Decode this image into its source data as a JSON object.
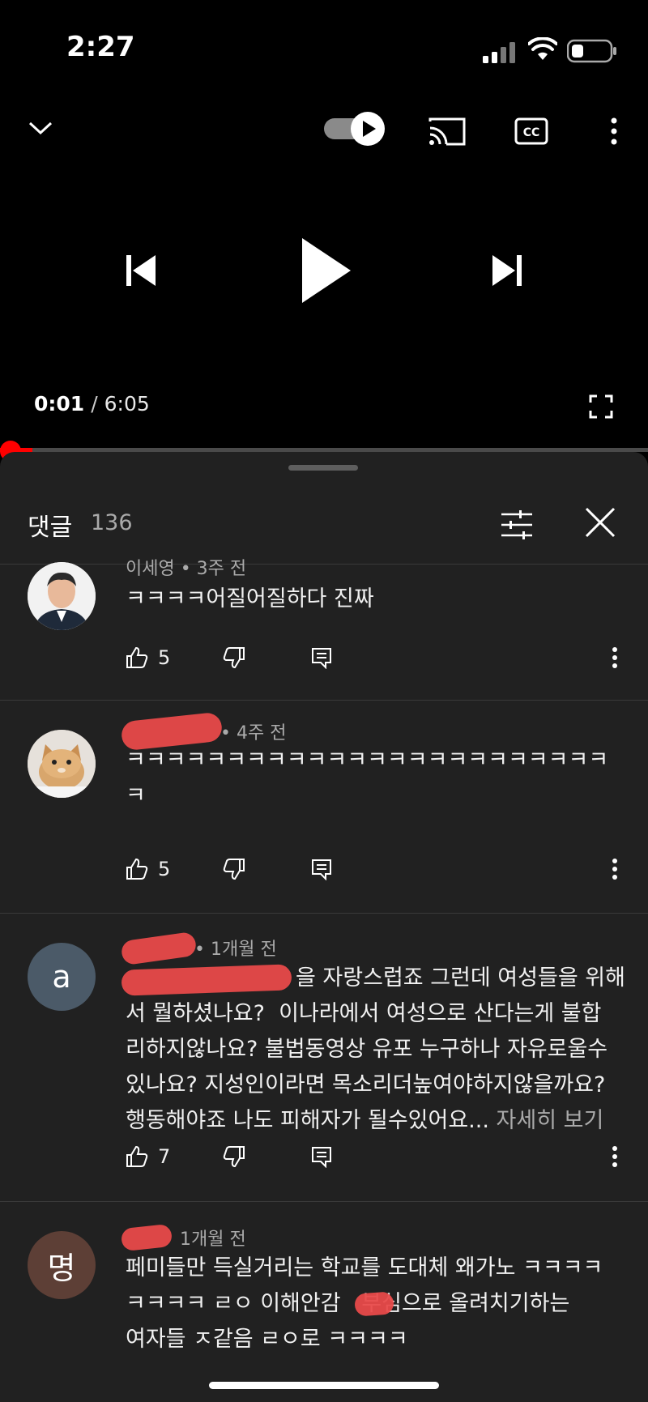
{
  "status": {
    "time": "2:27"
  },
  "player": {
    "current_time": "0:01",
    "separator": "/",
    "duration": "6:05",
    "progress_fraction": 0.003,
    "autoplay_enabled": true,
    "icons": [
      "chevron-down-icon",
      "autoplay-toggle-icon",
      "cast-icon",
      "captions-icon",
      "more-vert-icon",
      "previous-icon",
      "play-icon",
      "next-icon",
      "fullscreen-icon"
    ]
  },
  "comments_panel": {
    "title": "댓글",
    "count": "136",
    "comments": [
      {
        "meta": "이세영 • 3주 전",
        "text": "ㅋㅋㅋㅋ어질어질하다 진짜",
        "likes": "5",
        "avatar_kind": "photo"
      },
      {
        "meta": "• 4주 전",
        "text": "ㅋㅋㅋㅋㅋㅋㅋㅋㅋㅋㅋㅋㅋㅋㅋㅋㅋㅋㅋㅋㅋㅋㅋㅋ\nㅋ",
        "likes": "5",
        "avatar_kind": "cat"
      },
      {
        "meta": "• 1개월 전",
        "avatar_letter": "a",
        "text": "을 자랑스럽죠 그런데 여성들을 위해\n서 뭘하셨나요?  이나라에서 여성으로 산다는게 불합\n리하지않나요? 불법동영상 유포 누구하나 자유로울수\n있나요? 지성인이라면 목소리더높여야하지않을까요?\n행동해야죠 나도 피해자가 될수있어요...",
        "more": "자세히 보기",
        "likes": "7"
      },
      {
        "meta": "1개월 전",
        "avatar_letter": "명",
        "text": "페미들만 득실거리는 학교를 도대체 왜가노 ㅋㅋㅋㅋ\nㅋㅋㅋㅋ ㄹㅇ 이해안감   부심으로 올려치기하는\n여자들 ㅈ같음 ㄹㅇ로 ㅋㅋㅋㅋ"
      }
    ]
  },
  "colors": {
    "progress": "#ff0000",
    "sheet_bg": "#212121",
    "avatar_a": "#4b5a68",
    "avatar_m": "#5d3f36"
  }
}
